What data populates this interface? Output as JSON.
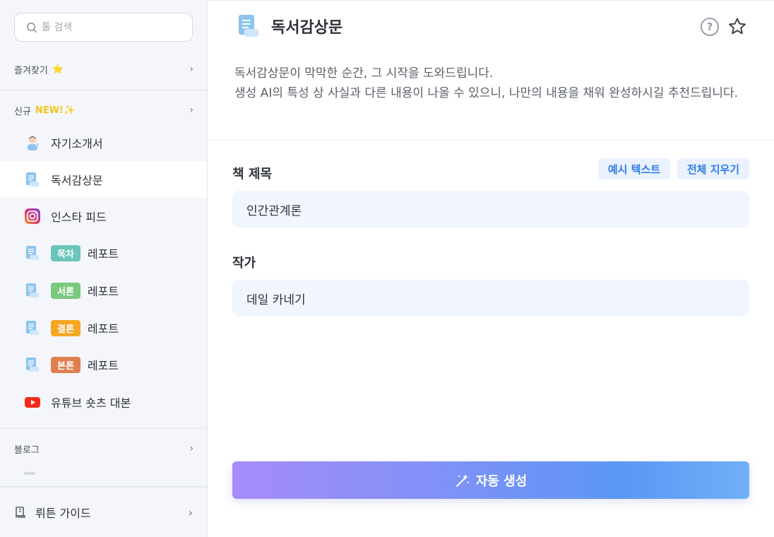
{
  "sidebar": {
    "search_placeholder": "툴 검색",
    "favorites": {
      "label": "즐겨찾기",
      "star": "⭐"
    },
    "new_section": {
      "label": "신규",
      "badge": "NEW!✨"
    },
    "items": [
      {
        "label": "자기소개서",
        "icon": "person-icon"
      },
      {
        "label": "독서감상문",
        "icon": "document-icon",
        "active": true
      },
      {
        "label": "인스타 피드",
        "icon": "instagram-icon"
      },
      {
        "badge": "목차",
        "badge_color": "#6cc5b9",
        "label": "레포트",
        "icon": "document-icon"
      },
      {
        "badge": "서론",
        "badge_color": "#79c97f",
        "label": "레포트",
        "icon": "document-icon"
      },
      {
        "badge": "결론",
        "badge_color": "#f5a623",
        "label": "레포트",
        "icon": "document-icon"
      },
      {
        "badge": "본론",
        "badge_color": "#e07f4e",
        "label": "레포트",
        "icon": "document-icon"
      },
      {
        "label": "유튜브 숏츠 대본",
        "icon": "youtube-icon"
      }
    ],
    "blog_section": {
      "label": "블로그"
    },
    "guide": {
      "label": "뤼튼 가이드"
    }
  },
  "main": {
    "title": "독서감상문",
    "description_line1": "독서감상문이 막막한 순간, 그 시작을 도와드립니다.",
    "description_line2": "생성 AI의 특성 상 사실과 다른 내용이 나올 수 있으니, 나만의 내용을 채워 완성하시길 추천드립니다.",
    "example_button": "예시 텍스트",
    "clear_button": "전체 지우기",
    "fields": {
      "book_title": {
        "label": "책 제목",
        "value": "인간관계론"
      },
      "author": {
        "label": "작가",
        "value": "데일 카네기"
      }
    },
    "generate_button": "자동 생성"
  },
  "colors": {
    "accent": "#2f7be5",
    "sidebar_bg": "#f4f6fb",
    "input_bg": "#f1f5fd"
  }
}
